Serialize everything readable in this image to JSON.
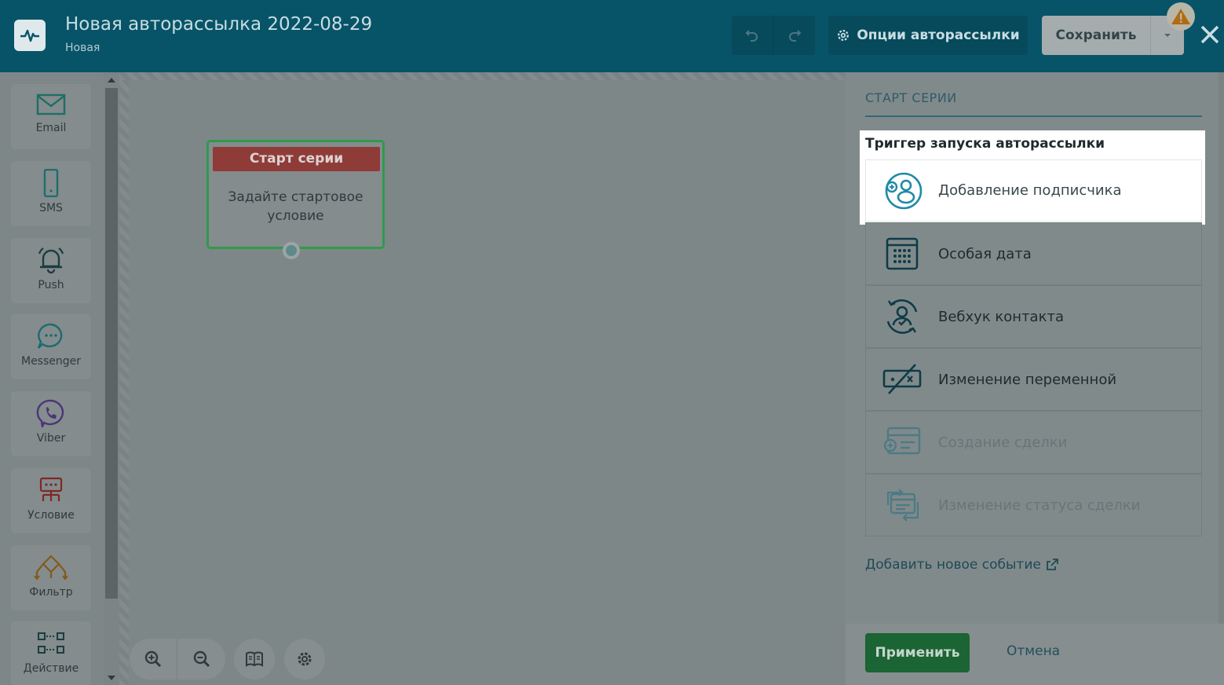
{
  "header": {
    "title": "Новая авторассылка 2022-08-29",
    "status": "Новая",
    "options_label": "Опции авторассылки",
    "save_label": "Сохранить"
  },
  "palette": [
    {
      "label": "Email",
      "icon": "envelope-icon"
    },
    {
      "label": "SMS",
      "icon": "phone-icon"
    },
    {
      "label": "Push",
      "icon": "bell-icon"
    },
    {
      "label": "Messenger",
      "icon": "chat-bubble-icon"
    },
    {
      "label": "Viber",
      "icon": "viber-icon"
    },
    {
      "label": "Условие",
      "icon": "condition-icon"
    },
    {
      "label": "Фильтр",
      "icon": "filter-icon"
    },
    {
      "label": "Действие",
      "icon": "action-icon"
    }
  ],
  "node": {
    "title": "Старт серии",
    "body": "Задайте стартовое условие"
  },
  "panel": {
    "title": "СТАРТ СЕРИИ",
    "trigger_label": "Триггер запуска авторассылки",
    "options": [
      {
        "label": "Добавление подписчика",
        "icon": "add-subscriber-icon",
        "state": "selected"
      },
      {
        "label": "Особая дата",
        "icon": "calendar-icon",
        "state": "normal"
      },
      {
        "label": "Вебхук контакта",
        "icon": "webhook-contact-icon",
        "state": "normal"
      },
      {
        "label": "Изменение переменной",
        "icon": "variable-change-icon",
        "state": "normal"
      },
      {
        "label": "Создание сделки",
        "icon": "deal-create-icon",
        "state": "disabled"
      },
      {
        "label": "Изменение статуса сделки",
        "icon": "deal-status-icon",
        "state": "disabled"
      }
    ],
    "add_event": "Добавить новое событие",
    "apply": "Применить",
    "cancel": "Отмена"
  },
  "colors": {
    "header_bg": "#075468",
    "accent_green": "#1b6434",
    "node_head": "#8f3c39",
    "icon_teal": "#1f8aa6"
  }
}
